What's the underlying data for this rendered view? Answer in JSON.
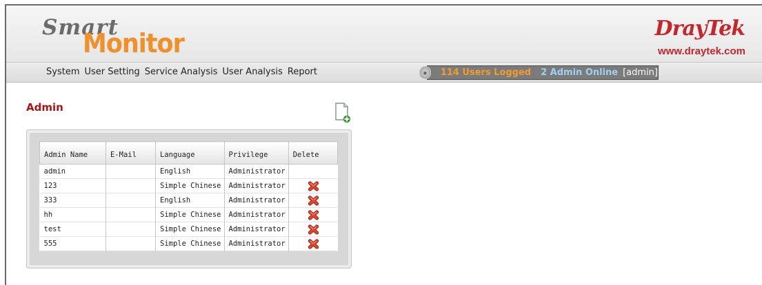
{
  "app": {
    "logo_smart": "Smart",
    "logo_monitor": "Monitor",
    "brand": "DrayTek",
    "brand_url": "www.draytek.com"
  },
  "menu": {
    "items": [
      "System",
      "User Setting",
      "Service Analysis",
      "User Analysis",
      "Report"
    ]
  },
  "status": {
    "users_logged": "114 Users Logged",
    "admin_online": "2 Admin Online",
    "current_user": "[admin]",
    "icon": "status-orb-icon"
  },
  "page": {
    "title": "Admin",
    "add_icon": "add-document-icon"
  },
  "table": {
    "columns": [
      "Admin Name",
      "E-Mail",
      "Language",
      "Privilege",
      "Delete"
    ],
    "rows": [
      {
        "name": "admin",
        "email": "",
        "language": "English",
        "privilege": "Administrator",
        "deletable": false
      },
      {
        "name": "123",
        "email": "",
        "language": "Simple Chinese",
        "privilege": "Administrator",
        "deletable": true
      },
      {
        "name": "333",
        "email": "",
        "language": "English",
        "privilege": "Administrator",
        "deletable": true
      },
      {
        "name": "hh",
        "email": "",
        "language": "Simple Chinese",
        "privilege": "Administrator",
        "deletable": true
      },
      {
        "name": "test",
        "email": "",
        "language": "Simple Chinese",
        "privilege": "Administrator",
        "deletable": true
      },
      {
        "name": "555",
        "email": "",
        "language": "Simple Chinese",
        "privilege": "Administrator",
        "deletable": true
      }
    ],
    "delete_icon": "delete-x-icon"
  },
  "colors": {
    "title": "#b01515",
    "monitor": "#f0902a",
    "brand": "#c7242b",
    "users_logged": "#f39b2d",
    "admin_online": "#9fd0f1",
    "link": "#2f67a8"
  }
}
